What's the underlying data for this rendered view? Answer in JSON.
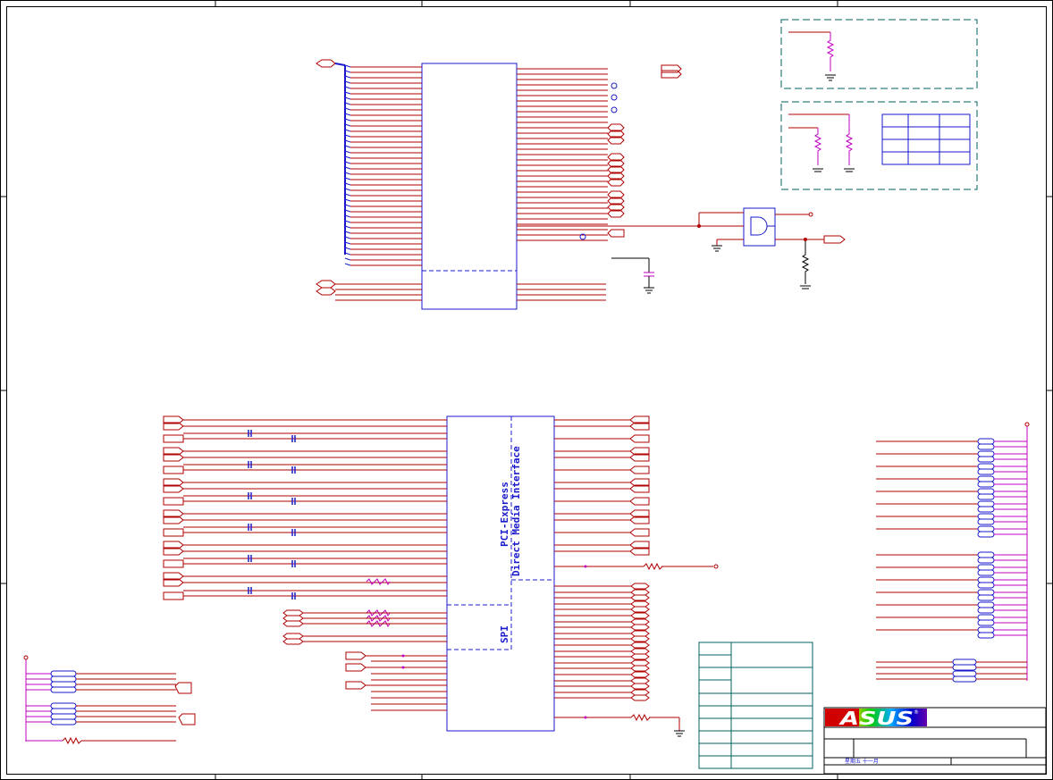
{
  "blocks": {
    "pcie_label": "PCI-Express",
    "dmi_label": "Direct Media Interface",
    "spi_label": "SPI"
  },
  "title_block": {
    "logo": "ASUS",
    "registered_mark": "®",
    "date": "星期五 十一月"
  },
  "colors": {
    "frame": "#000000",
    "wire": "#b00000",
    "wire_dark": "#1a1acc",
    "bus": "#1a1acc",
    "component": "#1a1acc",
    "resistor_pink": "#c000c0",
    "table_frame": "#006060",
    "logo_red": "#d00000"
  }
}
